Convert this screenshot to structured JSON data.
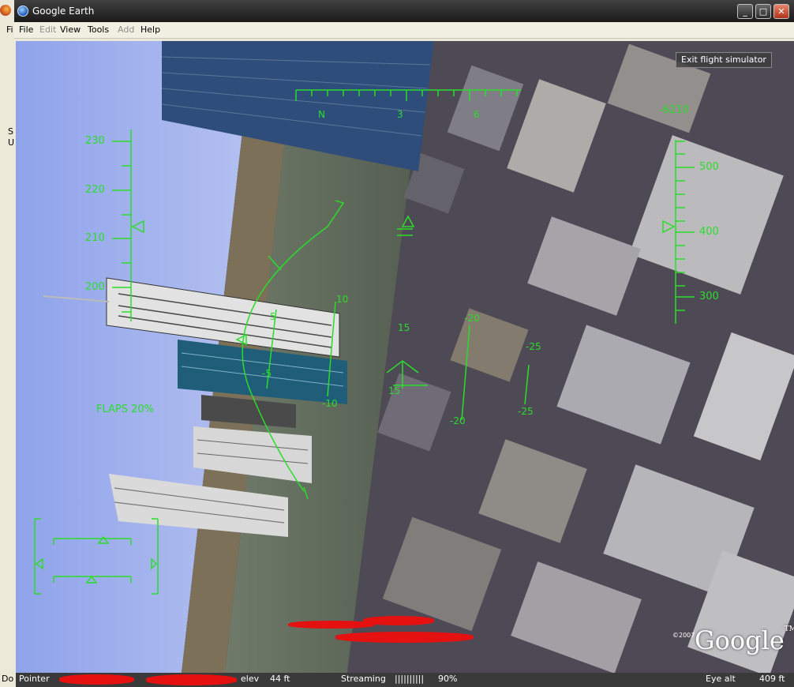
{
  "window": {
    "title": "Google Earth"
  },
  "menu": {
    "file": "File",
    "edit": "Edit",
    "view": "View",
    "tools": "Tools",
    "add": "Add",
    "help": "Help"
  },
  "titlebar_buttons": {
    "minimize": "_",
    "maximize": "□",
    "close": "✕"
  },
  "viewport": {
    "exit_button": "Exit flight simulator",
    "copyright": "©2007",
    "logo": "Google",
    "logo_tm": "TM"
  },
  "hud": {
    "heading_ticks": [
      "N",
      "3",
      "6"
    ],
    "vertical_speed": "-6210",
    "speed_ticks": [
      "230",
      "220",
      "210",
      "200"
    ],
    "altitude_ticks": [
      "500",
      "400",
      "300"
    ],
    "pitch_labels": [
      "15",
      "15",
      "-20",
      "-20",
      "-25",
      "-25",
      "5",
      "-5",
      "10",
      "-10"
    ],
    "flaps": "FLAPS 20%"
  },
  "status": {
    "pointer_label": "Pointer",
    "elev_label": "elev",
    "elev_value": "44 ft",
    "streaming_label": "Streaming",
    "streaming_bar": "||||||||||",
    "streaming_value": "90%",
    "eye_alt_label": "Eye alt",
    "eye_alt_value": "409 ft"
  },
  "background_app": {
    "menu_fragment": "Fi",
    "sidebar_fragment_1": "S",
    "sidebar_fragment_2": "U",
    "status_fragment": "Do"
  },
  "colors": {
    "hud": "#2bdc2b",
    "title_bar": "#2a2a2a",
    "redaction": "#e51010"
  }
}
